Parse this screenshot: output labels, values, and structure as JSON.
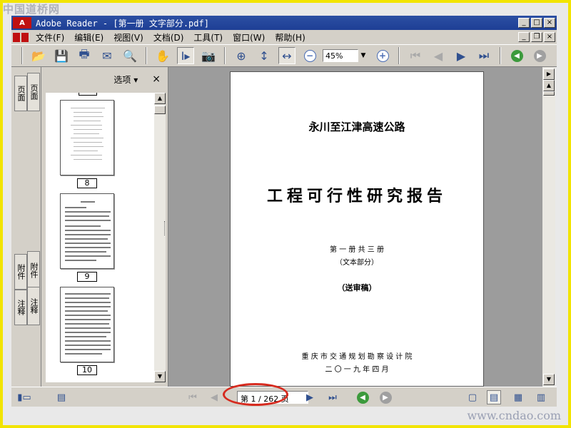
{
  "watermarks": {
    "top": "中国道桥网",
    "bottom": "www.cndao.com"
  },
  "window": {
    "title": "Adobe Reader - [第一册  文字部分.pdf]",
    "app_logo": "A",
    "buttons": [
      "minimize",
      "maximize",
      "close"
    ]
  },
  "menu": {
    "items": [
      "文件(F)",
      "编辑(E)",
      "视图(V)",
      "文档(D)",
      "工具(T)",
      "窗口(W)",
      "帮助(H)"
    ]
  },
  "toolbar": {
    "icons": [
      "open-icon",
      "save-icon",
      "print-icon",
      "email-icon",
      "search-icon",
      "hand-icon",
      "select-text-icon",
      "snapshot-icon",
      "zoom-in-tool-icon",
      "fit-page-icon",
      "fit-width-icon",
      "zoom-out-icon",
      "zoom-in-icon",
      "first-page-icon",
      "prev-page-icon",
      "next-page-icon",
      "last-page-icon",
      "back-icon",
      "forward-icon"
    ],
    "zoom_value": "45%"
  },
  "side_tabs": [
    "页面",
    "页面",
    "附件",
    "附件",
    "注释",
    "注释"
  ],
  "panel": {
    "options_label": "选项 ▾",
    "close": "×",
    "thumbnails": [
      {
        "label": "8",
        "selected": false
      },
      {
        "label": "9",
        "selected": false
      },
      {
        "label": "10",
        "selected": false
      }
    ]
  },
  "document": {
    "subtitle": "永川至江津高速公路",
    "title": "工程可行性研究报告",
    "volume": "第 一 册    共 三 册",
    "part": "（文本部分）",
    "status": "（送审稿）",
    "org": "重 庆 市 交 通 规 划 勘 察 设 计 院",
    "date": "二 〇 一 九 年 四 月"
  },
  "statusbar": {
    "page_indicator": "第 1 / 262 页",
    "current_page": 1,
    "total_pages": 262
  },
  "colors": {
    "frame": "#f2e400",
    "titlebar": "#2c4fa3",
    "highlight": "#d62a1e"
  }
}
